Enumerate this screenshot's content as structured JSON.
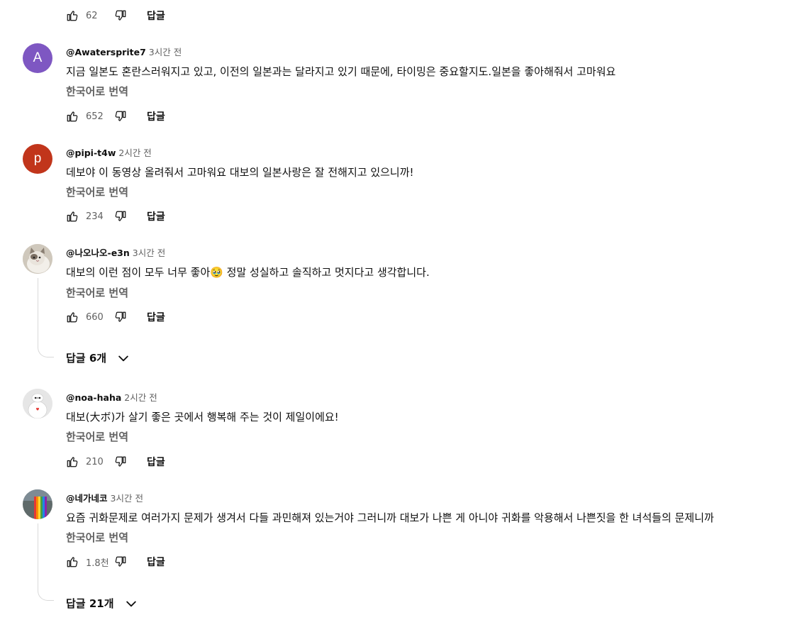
{
  "comments": [
    {
      "like_count": "62",
      "reply_label": "답글"
    },
    {
      "avatar_letter": "A",
      "avatar_color": "#7e57c2",
      "author": "@Awatersprite7",
      "time": "3시간 전",
      "text": "지금 일본도 혼란스러워지고 있고, 이전의 일본과는 달라지고 있기 때문에, 타이밍은 중요할지도.일본을 좋아해줘서  고마워요",
      "translate": "한국어로 번역",
      "like_count": "652",
      "reply_label": "답글"
    },
    {
      "avatar_letter": "p",
      "avatar_color": "#c1351b",
      "author": "@pipi-t4w",
      "time": "2시간 전",
      "text": "데보야 이 동영상 올려줘서  고마워요 대보의 일본사랑은 잘 전해지고 있으니까!",
      "translate": "한국어로 번역",
      "like_count": "234",
      "reply_label": "답글"
    },
    {
      "author": "@나오나오-e3n",
      "time": "3시간 전",
      "text": "대보의 이런 점이 모두 너무 좋아🥹  정말 성실하고 솔직하고 멋지다고 생각합니다.",
      "translate": "한국어로 번역",
      "like_count": "660",
      "reply_label": "답글",
      "replies_label": "답글 6개"
    },
    {
      "author": "@noa-haha",
      "time": "2시간 전",
      "text": "대보(大ボ)가 살기 좋은 곳에서 행복해 주는 것이 제일이에요!",
      "translate": "한국어로 번역",
      "like_count": "210",
      "reply_label": "답글"
    },
    {
      "author": "@네가네코",
      "time": "3시간 전",
      "text": "요즘 귀화문제로 여러가지 문제가 생겨서 다들 과민해져 있는거야 그러니까 대보가 나쁜 게 아니야 귀화를 악용해서 나쁜짓을 한 녀석들의 문제니까",
      "translate": "한국어로 번역",
      "like_count": "1.8천",
      "reply_label": "답글",
      "replies_label": "답글 21개"
    }
  ]
}
